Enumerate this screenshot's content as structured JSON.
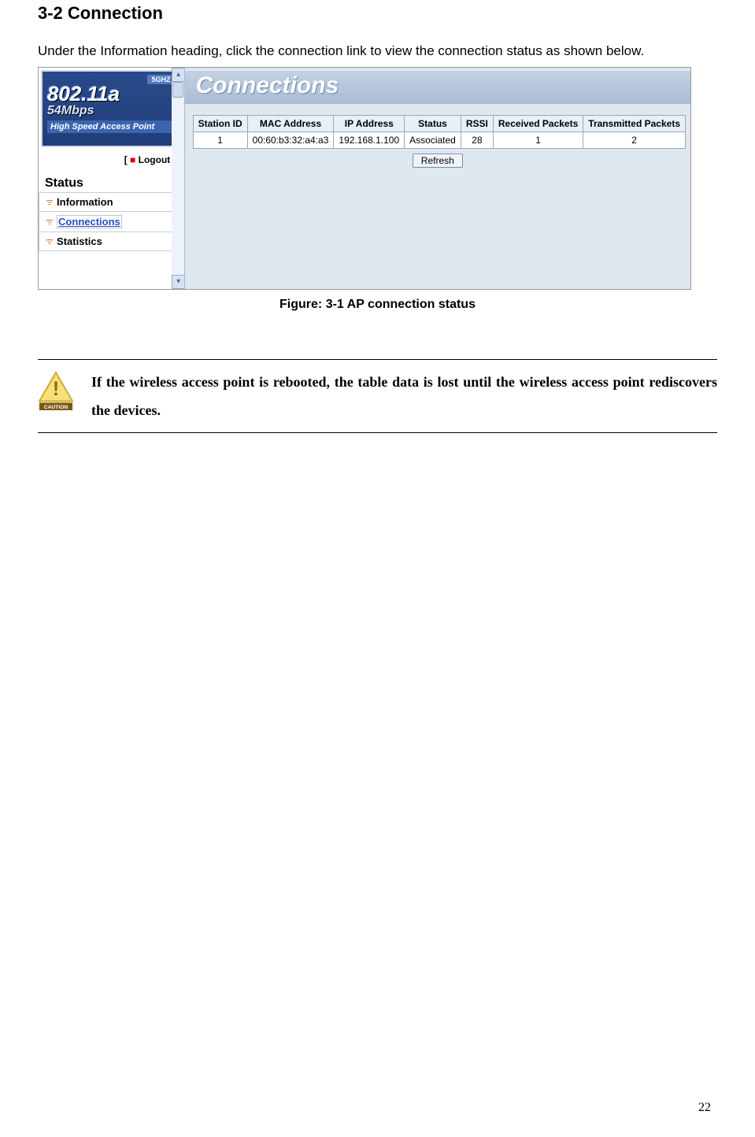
{
  "heading": "3-2  Connection",
  "intro": "Under the Information heading, click the connection link to view the connection status as shown below.",
  "screenshot": {
    "brand": {
      "ghz": "5GHZ",
      "line1": "802.11a",
      "line2": "54Mbps",
      "line3": "High Speed Access Point"
    },
    "logout": "Logout",
    "status_header": "Status",
    "nav": {
      "information": "Information",
      "connections": "Connections",
      "statistics": "Statistics"
    },
    "main_title": "Connections",
    "table": {
      "headers": {
        "station_id": "Station ID",
        "mac": "MAC Address",
        "ip": "IP Address",
        "status": "Status",
        "rssi": "RSSI",
        "rx": "Received Packets",
        "tx": "Transmitted Packets"
      },
      "row": {
        "station_id": "1",
        "mac": "00:60:b3:32:a4:a3",
        "ip": "192.168.1.100",
        "status": "Associated",
        "rssi": "28",
        "rx": "1",
        "tx": "2"
      }
    },
    "refresh_label": "Refresh"
  },
  "figure_caption": "Figure: 3-1 AP connection status",
  "caution": {
    "label": "CAUTION",
    "text": "If the wireless access point is rebooted, the table data is lost until the wireless access point rediscovers the devices."
  },
  "page_number": "22"
}
